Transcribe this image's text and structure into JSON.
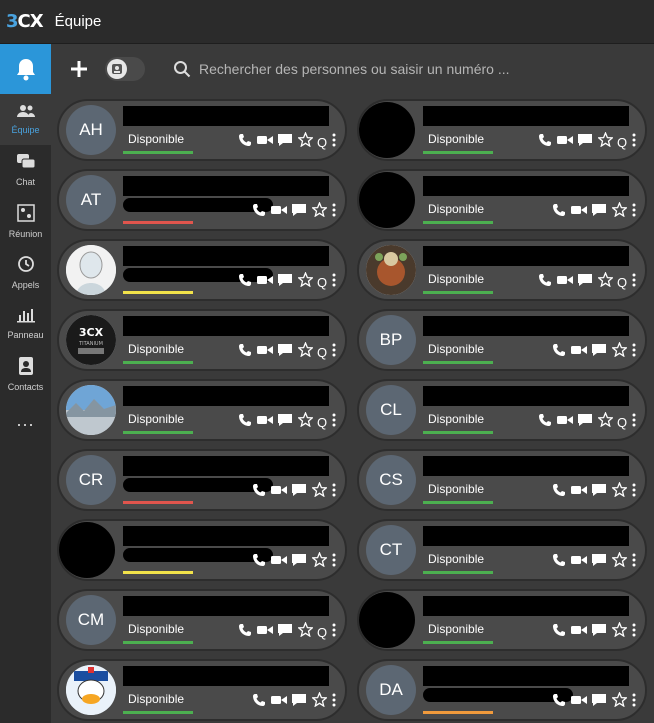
{
  "app": {
    "brand_prefix": "3",
    "brand_suffix": "CX",
    "title": "Équipe"
  },
  "nav": {
    "items": [
      {
        "id": "equipe",
        "label": "Équipe",
        "icon": "users-icon",
        "active": true
      },
      {
        "id": "chat",
        "label": "Chat",
        "icon": "chat-icon",
        "active": false
      },
      {
        "id": "reunion",
        "label": "Réunion",
        "icon": "meeting-icon",
        "active": false
      },
      {
        "id": "appels",
        "label": "Appels",
        "icon": "history-icon",
        "active": false
      },
      {
        "id": "panneau",
        "label": "Panneau",
        "icon": "panel-icon",
        "active": false
      },
      {
        "id": "contacts",
        "label": "Contacts",
        "icon": "contacts-icon",
        "active": false
      }
    ],
    "more": "..."
  },
  "search": {
    "placeholder": "Rechercher des personnes ou saisir un numéro ..."
  },
  "colors": {
    "accent": "#2b96d9",
    "green": "#4caf50",
    "red": "#e0554d",
    "yellow": "#f1e24a",
    "orange": "#f09a3c"
  },
  "contacts": [
    {
      "initials": "AH",
      "avatar": "initials",
      "status": "Disponible",
      "presence": "green",
      "q": true
    },
    {
      "initials": "",
      "avatar": "black",
      "status": "Disponible",
      "presence": "green",
      "q": true
    },
    {
      "initials": "AT",
      "avatar": "initials",
      "status": "",
      "presence": "red",
      "q": false
    },
    {
      "initials": "",
      "avatar": "black",
      "status": "Disponible",
      "presence": "green",
      "q": false
    },
    {
      "initials": "",
      "avatar": "img-cartoon",
      "status": "",
      "presence": "yellow",
      "q": true
    },
    {
      "initials": "",
      "avatar": "img-figure",
      "status": "Disponible",
      "presence": "green",
      "q": true
    },
    {
      "initials": "",
      "avatar": "img-3cx",
      "status": "Disponible",
      "presence": "green",
      "q": true
    },
    {
      "initials": "BP",
      "avatar": "initials",
      "status": "Disponible",
      "presence": "green",
      "q": false
    },
    {
      "initials": "",
      "avatar": "img-landscape",
      "status": "Disponible",
      "presence": "green",
      "q": true
    },
    {
      "initials": "CL",
      "avatar": "initials",
      "status": "Disponible",
      "presence": "green",
      "q": true
    },
    {
      "initials": "CR",
      "avatar": "initials",
      "status": "",
      "presence": "red",
      "q": false
    },
    {
      "initials": "CS",
      "avatar": "initials",
      "status": "Disponible",
      "presence": "green",
      "q": false
    },
    {
      "initials": "",
      "avatar": "black",
      "status": "",
      "presence": "yellow",
      "q": false
    },
    {
      "initials": "CT",
      "avatar": "initials",
      "status": "Disponible",
      "presence": "green",
      "q": false
    },
    {
      "initials": "CM",
      "avatar": "initials",
      "status": "Disponible",
      "presence": "green",
      "q": true
    },
    {
      "initials": "",
      "avatar": "black",
      "status": "Disponible",
      "presence": "green",
      "q": false
    },
    {
      "initials": "",
      "avatar": "img-duck",
      "status": "Disponible",
      "presence": "green",
      "q": false
    },
    {
      "initials": "DA",
      "avatar": "initials",
      "status": "",
      "presence": "orange",
      "q": false
    }
  ]
}
